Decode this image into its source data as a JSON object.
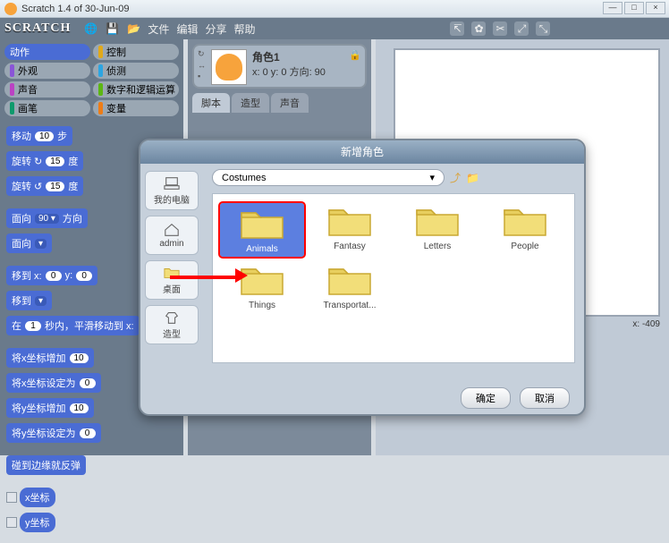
{
  "window": {
    "title": "Scratch 1.4 of 30-Jun-09",
    "min": "—",
    "max": "□",
    "close": "×"
  },
  "toolbar": {
    "logo": "SCRATCH",
    "globe": "🌐",
    "save": "💾",
    "saveas": "📂",
    "menus": {
      "file": "文件",
      "edit": "编辑",
      "share": "分享",
      "help": "帮助"
    },
    "right_icons": {
      "pointer": "↸",
      "stamp": "✿",
      "scissors": "✂",
      "grow": "⤢",
      "shrink": "⤡"
    }
  },
  "categories": {
    "motion": "动作",
    "control": "控制",
    "looks": "外观",
    "sensing": "侦测",
    "sound": "声音",
    "operators": "数字和逻辑运算",
    "pen": "画笔",
    "variables": "变量"
  },
  "blocks": {
    "move": {
      "pre": "移动",
      "n": "10",
      "post": "步"
    },
    "turn_cw": {
      "pre": "旋转 ↻",
      "n": "15",
      "post": "度"
    },
    "turn_ccw": {
      "pre": "旋转 ↺",
      "n": "15",
      "post": "度"
    },
    "point_dir": {
      "pre": "面向",
      "d": "90 ▾",
      "post": "方向"
    },
    "point_to": {
      "pre": "面向",
      "d": " ▾"
    },
    "goto_xy": {
      "pre": "移到 x:",
      "x": "0",
      "mid": "y:",
      "y": "0"
    },
    "goto": {
      "pre": "移到",
      "d": " ▾"
    },
    "glide": {
      "pre": "在",
      "n": "1",
      "post": "秒内，平滑移动到 x:"
    },
    "change_x": {
      "pre": "将x坐标增加",
      "n": "10"
    },
    "set_x": {
      "pre": "将x坐标设定为",
      "n": "0"
    },
    "change_y": {
      "pre": "将y坐标增加",
      "n": "10"
    },
    "set_y": {
      "pre": "将y坐标设定为",
      "n": "0"
    },
    "bounce": "碰到边缘就反弹",
    "xpos": "x坐标",
    "ypos": "y坐标"
  },
  "sprite": {
    "name": "角色1",
    "coords": "x: 0    y: 0    方向: 90",
    "tabs": {
      "scripts": "脚本",
      "costumes": "造型",
      "sounds": "声音"
    }
  },
  "stage": {
    "coords": "x: -409"
  },
  "dialog": {
    "title": "新增角色",
    "side": {
      "computer": "我的电脑",
      "admin": "admin",
      "desktop": "桌面",
      "costumes": "造型"
    },
    "path_current": "Costumes",
    "drop_arrow": "▾",
    "folders": {
      "animals": "Animals",
      "fantasy": "Fantasy",
      "letters": "Letters",
      "people": "People",
      "things": "Things",
      "transport": "Transportat..."
    },
    "ok": "确定",
    "cancel": "取消"
  }
}
